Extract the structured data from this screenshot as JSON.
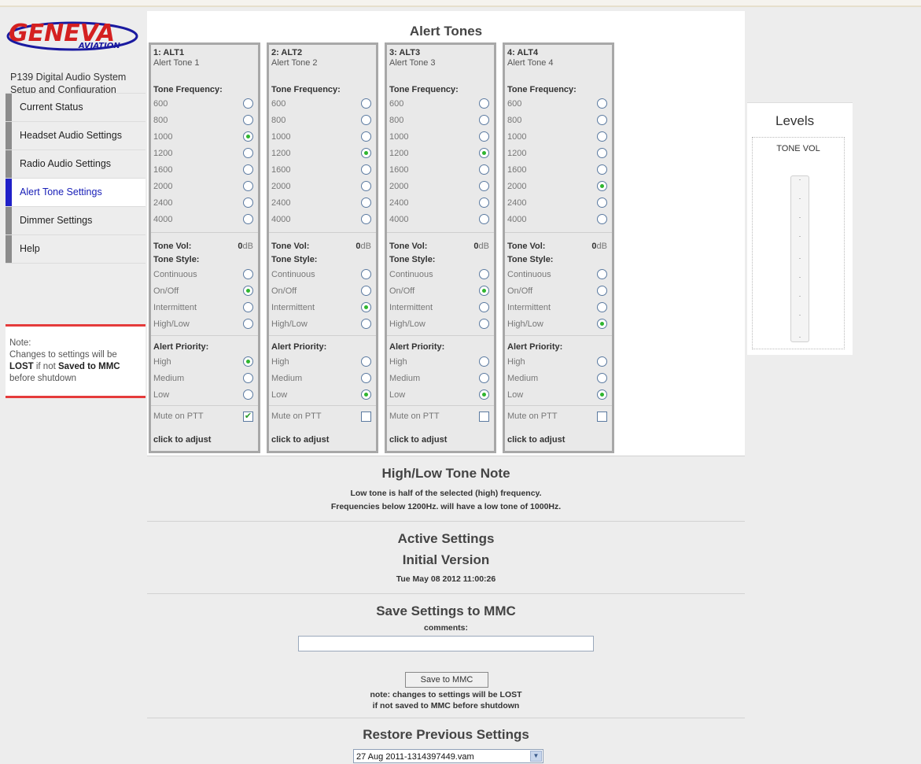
{
  "brand": {
    "logo_main": "GENEVA",
    "logo_sub": "AVIATION"
  },
  "app": {
    "subtitle_line1": "P139 Digital Audio System",
    "subtitle_line2": "Setup and Configuration"
  },
  "nav": [
    {
      "label": "Current Status",
      "active": false
    },
    {
      "label": "Headset Audio Settings",
      "active": false
    },
    {
      "label": "Radio Audio Settings",
      "active": false
    },
    {
      "label": "Alert Tone Settings",
      "active": true
    },
    {
      "label": "Dimmer Settings",
      "active": false
    },
    {
      "label": "Help",
      "active": false
    }
  ],
  "note": {
    "title": "Note:",
    "line1": "Changes to settings will be",
    "lost": "LOST",
    "not": " if not ",
    "saved": "Saved to MMC",
    "line3": "before shutdown"
  },
  "alert_tones": {
    "title": "Alert Tones",
    "labels": {
      "freq": "Tone Frequency:",
      "vol": "Tone Vol:",
      "style": "Tone Style:",
      "priority": "Alert Priority:",
      "mute": "Mute on PTT",
      "click": "click to adjust",
      "db": "dB"
    },
    "frequencies": [
      "600",
      "800",
      "1000",
      "1200",
      "1600",
      "2000",
      "2400",
      "4000"
    ],
    "styles": [
      "Continuous",
      "On/Off",
      "Intermittent",
      "High/Low"
    ],
    "priorities": [
      "High",
      "Medium",
      "Low"
    ],
    "channels": [
      {
        "num": "1: ALT1",
        "name": "Alert Tone 1",
        "freq": "1000",
        "vol": "0",
        "style": "On/Off",
        "priority": "High",
        "mute": true
      },
      {
        "num": "2: ALT2",
        "name": "Alert Tone 2",
        "freq": "1200",
        "vol": "0",
        "style": "Intermittent",
        "priority": "Low",
        "mute": false
      },
      {
        "num": "3: ALT3",
        "name": "Alert Tone 3",
        "freq": "1200",
        "vol": "0",
        "style": "On/Off",
        "priority": "Low",
        "mute": false
      },
      {
        "num": "4: ALT4",
        "name": "Alert Tone 4",
        "freq": "2000",
        "vol": "0",
        "style": "High/Low",
        "priority": "Low",
        "mute": false
      }
    ]
  },
  "highlow": {
    "title": "High/Low Tone Note",
    "line1": "Low tone is half of the selected (high) frequency.",
    "line2": "Frequencies below 1200Hz. will have a low tone of 1000Hz."
  },
  "active": {
    "title": "Active Settings",
    "version": "Initial Version",
    "date": "Tue May 08 2012 11:00:26"
  },
  "save": {
    "title": "Save Settings to MMC",
    "comments_label": "comments:",
    "comments_value": "",
    "button": "Save to MMC",
    "note1": "note: changes to settings will be LOST",
    "note2": "if not saved to MMC before shutdown"
  },
  "restore": {
    "title": "Restore Previous Settings",
    "selected": "27 Aug 2011-1314397449.vam"
  },
  "levels": {
    "title": "Levels",
    "label": "TONE VOL"
  }
}
